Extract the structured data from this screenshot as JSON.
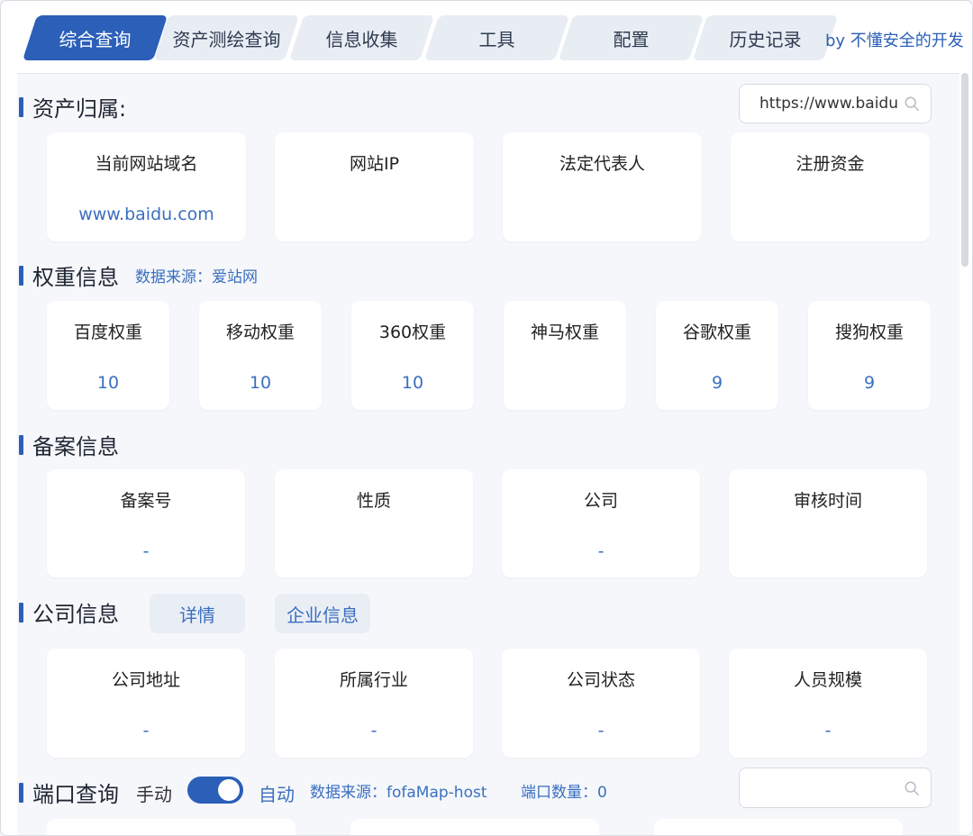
{
  "tabs": [
    {
      "label": "综合查询",
      "active": true
    },
    {
      "label": "资产测绘查询",
      "active": false
    },
    {
      "label": "信息收集",
      "active": false
    },
    {
      "label": "工具",
      "active": false
    },
    {
      "label": "配置",
      "active": false
    },
    {
      "label": "历史记录",
      "active": false
    }
  ],
  "byline": "by 不懂安全的开发",
  "asset": {
    "title": "资产归属:",
    "search_value": "https://www.baidu",
    "cards": [
      {
        "key": "当前网站域名",
        "value": "www.baidu.com"
      },
      {
        "key": "网站IP",
        "value": ""
      },
      {
        "key": "法定代表人",
        "value": ""
      },
      {
        "key": "注册资金",
        "value": ""
      }
    ]
  },
  "weight": {
    "title": "权重信息",
    "source": "数据来源：爱站网",
    "cards": [
      {
        "key": "百度权重",
        "value": "10"
      },
      {
        "key": "移动权重",
        "value": "10"
      },
      {
        "key": "360权重",
        "value": "10"
      },
      {
        "key": "神马权重",
        "value": ""
      },
      {
        "key": "谷歌权重",
        "value": "9"
      },
      {
        "key": "搜狗权重",
        "value": "9"
      }
    ]
  },
  "icp": {
    "title": "备案信息",
    "cards": [
      {
        "key": "备案号",
        "value": "-"
      },
      {
        "key": "性质",
        "value": ""
      },
      {
        "key": "公司",
        "value": "-"
      },
      {
        "key": "审核时间",
        "value": ""
      }
    ]
  },
  "company": {
    "title": "公司信息",
    "btn_detail": "详情",
    "btn_enterprise": "企业信息",
    "cards": [
      {
        "key": "公司地址",
        "value": "-"
      },
      {
        "key": "所属行业",
        "value": "-"
      },
      {
        "key": "公司状态",
        "value": "-"
      },
      {
        "key": "人员规模",
        "value": "-"
      }
    ]
  },
  "port": {
    "title": "端口查询",
    "manual": "手动",
    "auto": "自动",
    "toggle_on": true,
    "source": "数据来源：fofaMap-host",
    "count": "端口数量：0",
    "search_value": ""
  },
  "colors": {
    "accent": "#2b5fb8",
    "value_text": "#3b6fc0",
    "panel_bg": "#f5f7fa"
  }
}
